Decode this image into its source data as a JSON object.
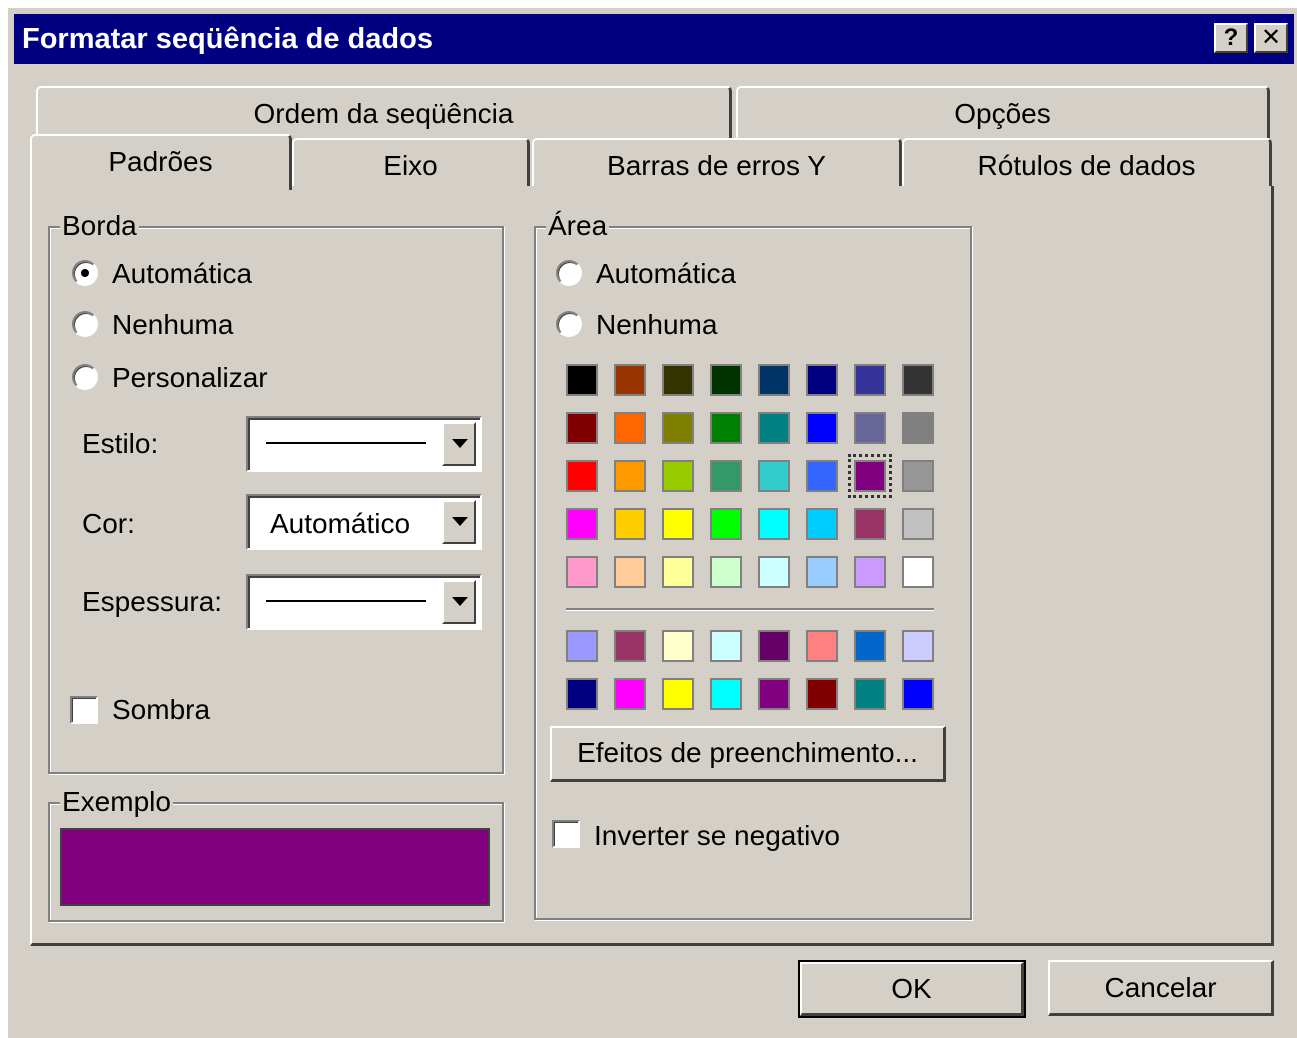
{
  "title_bar": {
    "title": "Formatar seqüência de dados",
    "help_button": "?",
    "close_button": "✕"
  },
  "tabs": {
    "back_row": [
      "Ordem da seqüência",
      "Opções"
    ],
    "front_row": [
      "Padrões",
      "Eixo",
      "Barras de erros Y",
      "Rótulos de dados"
    ],
    "active": "Padrões"
  },
  "borda": {
    "legend": "Borda",
    "options": [
      {
        "label": "Automática",
        "checked": true
      },
      {
        "label": "Nenhuma",
        "checked": false
      },
      {
        "label": "Personalizar",
        "checked": false
      }
    ],
    "estilo_label": "Estilo:",
    "cor_label": "Cor:",
    "cor_value": "Automático",
    "espessura_label": "Espessura:",
    "sombra_label": "Sombra",
    "sombra_checked": false
  },
  "exemplo": {
    "legend": "Exemplo",
    "color": "#800080"
  },
  "area": {
    "legend": "Área",
    "options": [
      {
        "label": "Automática",
        "checked": false
      },
      {
        "label": "Nenhuma",
        "checked": false
      }
    ],
    "palette": [
      [
        "#000000",
        "#993300",
        "#333300",
        "#003300",
        "#003366",
        "#000080",
        "#333399",
        "#333333"
      ],
      [
        "#800000",
        "#FF6600",
        "#808000",
        "#008000",
        "#008080",
        "#0000FF",
        "#666699",
        "#808080"
      ],
      [
        "#FF0000",
        "#FF9900",
        "#99CC00",
        "#339966",
        "#33CCCC",
        "#3366FF",
        "#800080",
        "#969696"
      ],
      [
        "#FF00FF",
        "#FFCC00",
        "#FFFF00",
        "#00FF00",
        "#00FFFF",
        "#00CCFF",
        "#993366",
        "#C0C0C0"
      ],
      [
        "#FF99CC",
        "#FFCC99",
        "#FFFF99",
        "#CCFFCC",
        "#CCFFFF",
        "#99CCFF",
        "#CC99FF",
        "#FFFFFF"
      ]
    ],
    "palette_extra": [
      [
        "#9999FF",
        "#993366",
        "#FFFFCC",
        "#CCFFFF",
        "#660066",
        "#FF8080",
        "#0066CC",
        "#CCCCFF"
      ],
      [
        "#000080",
        "#FF00FF",
        "#FFFF00",
        "#00FFFF",
        "#800080",
        "#800000",
        "#008080",
        "#0000FF"
      ]
    ],
    "selected_color": "#800080",
    "fill_effects_button": "Efeitos de preenchimento...",
    "inverter_label": "Inverter se negativo",
    "inverter_checked": false
  },
  "buttons": {
    "ok": "OK",
    "cancel": "Cancelar"
  }
}
